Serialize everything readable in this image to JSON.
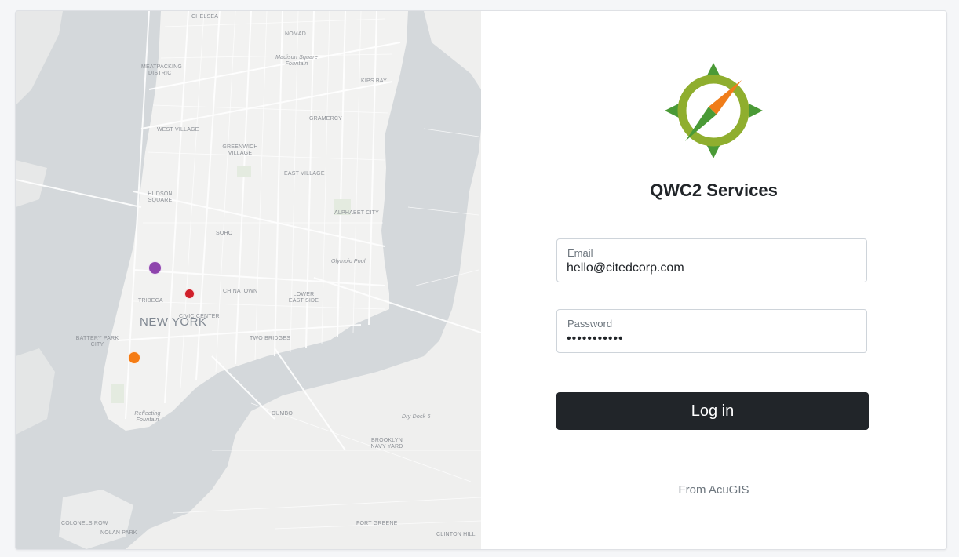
{
  "map": {
    "labels": {
      "chelsea": "CHELSEA",
      "nomad": "NOMAD",
      "madison_square": "Madison Square Fountain",
      "meatpacking": "MEATPACKING DISTRICT",
      "kips_bay": "KIPS BAY",
      "west_village": "WEST VILLAGE",
      "gramercy": "GRAMERCY",
      "greenwich": "GREENWICH VILLAGE",
      "east_village": "EAST VILLAGE",
      "hudson_square": "HUDSON SQUARE",
      "alphabet_city": "ALPHABET CITY",
      "soho": "SOHO",
      "olympic_pool": "Olympic Pool",
      "tribeca": "TRIBECA",
      "chinatown": "CHINATOWN",
      "lower_east_side": "LOWER EAST SIDE",
      "new_york": "NEW YORK",
      "civic_center": "CIVIC CENTER",
      "battery_park": "BATTERY PARK CITY",
      "two_bridges": "TWO BRIDGES",
      "reflecting_fountain": "Reflecting Fountain",
      "dumbo": "DUMBO",
      "dry_dock": "Dry Dock 6",
      "brooklyn_navy": "BROOKLYN NAVY YARD",
      "colonels_row": "COLONELS ROW",
      "nolan_park": "NOLAN PARK",
      "fort_greene": "FORT GREENE",
      "clinton_hill": "CLINTON HILL"
    },
    "markers": [
      {
        "name": "purple",
        "color": "#8e44ad"
      },
      {
        "name": "red",
        "color": "#d0202a"
      },
      {
        "name": "orange",
        "color": "#f57c14"
      }
    ]
  },
  "login": {
    "title": "QWC2 Services",
    "email_label": "Email",
    "email_value": "hello@citedcorp.com",
    "password_label": "Password",
    "password_value": "•••••••••••",
    "button_label": "Log in",
    "footer": "From AcuGIS",
    "logo_icon": "compass-icon",
    "colors": {
      "button_bg": "#212529",
      "logo_green": "#8fae2e",
      "logo_orange": "#f07d1a",
      "logo_dark_green": "#4a9a36"
    }
  }
}
